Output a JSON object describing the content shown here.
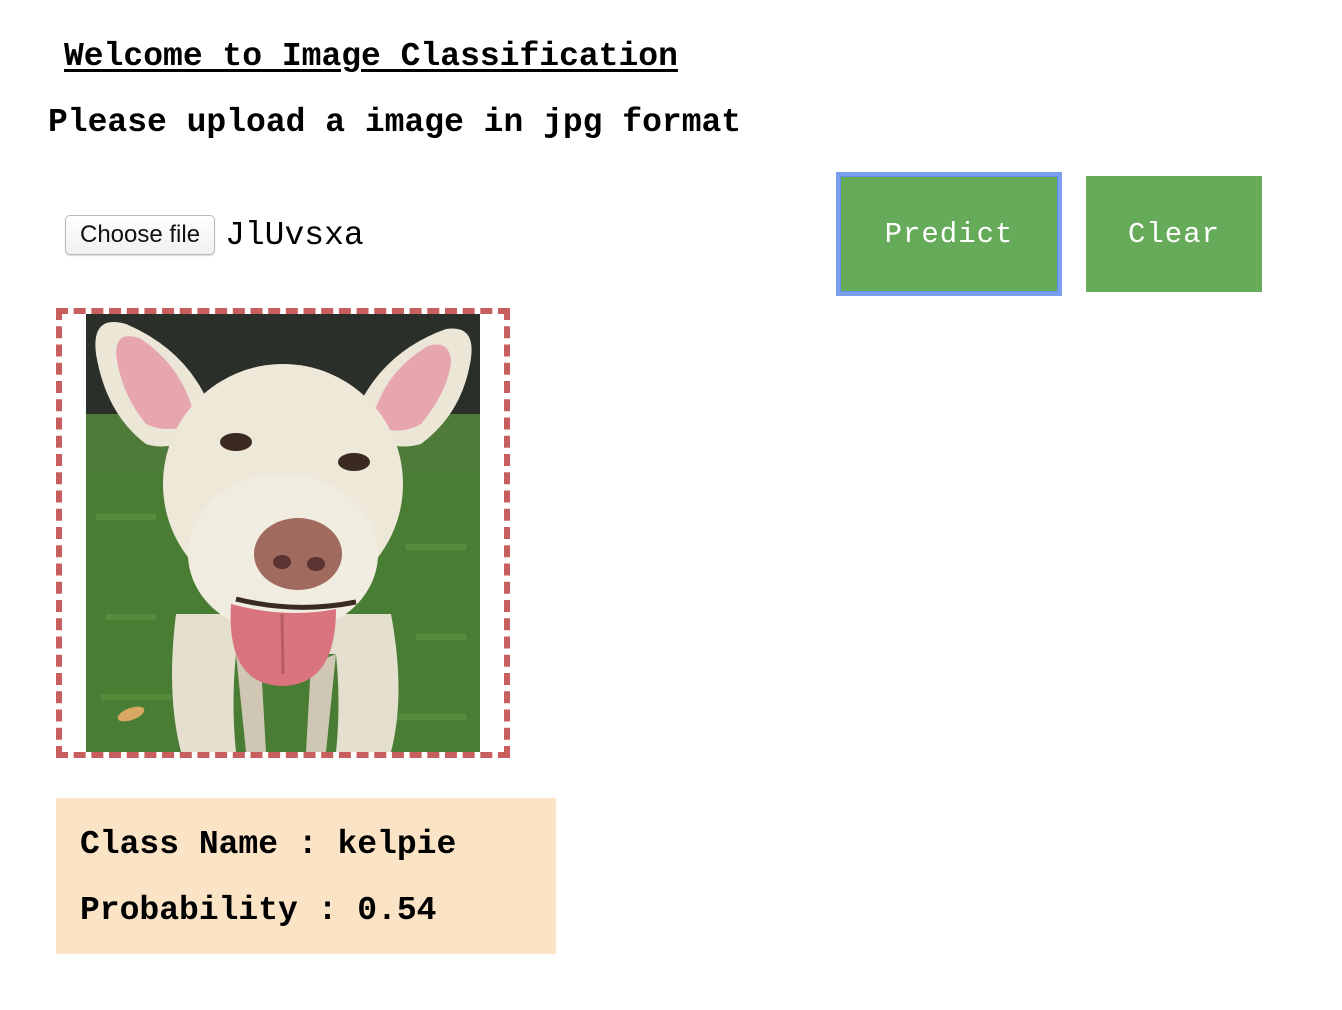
{
  "header": {
    "title": "Welcome to Image Classification",
    "subtitle": "Please upload a image in jpg format"
  },
  "upload": {
    "choose_file_label": "Choose file",
    "file_name": "JlUvsxa"
  },
  "actions": {
    "predict_label": "Predict",
    "clear_label": "Clear",
    "button_color": "#66ab59",
    "focus_ring_color": "#7a9ff0"
  },
  "preview": {
    "border_color": "#c85e5e"
  },
  "result": {
    "class_line": "Class Name : kelpie",
    "probability_line": "Probability : 0.54",
    "background_color": "#fbe3c6"
  }
}
